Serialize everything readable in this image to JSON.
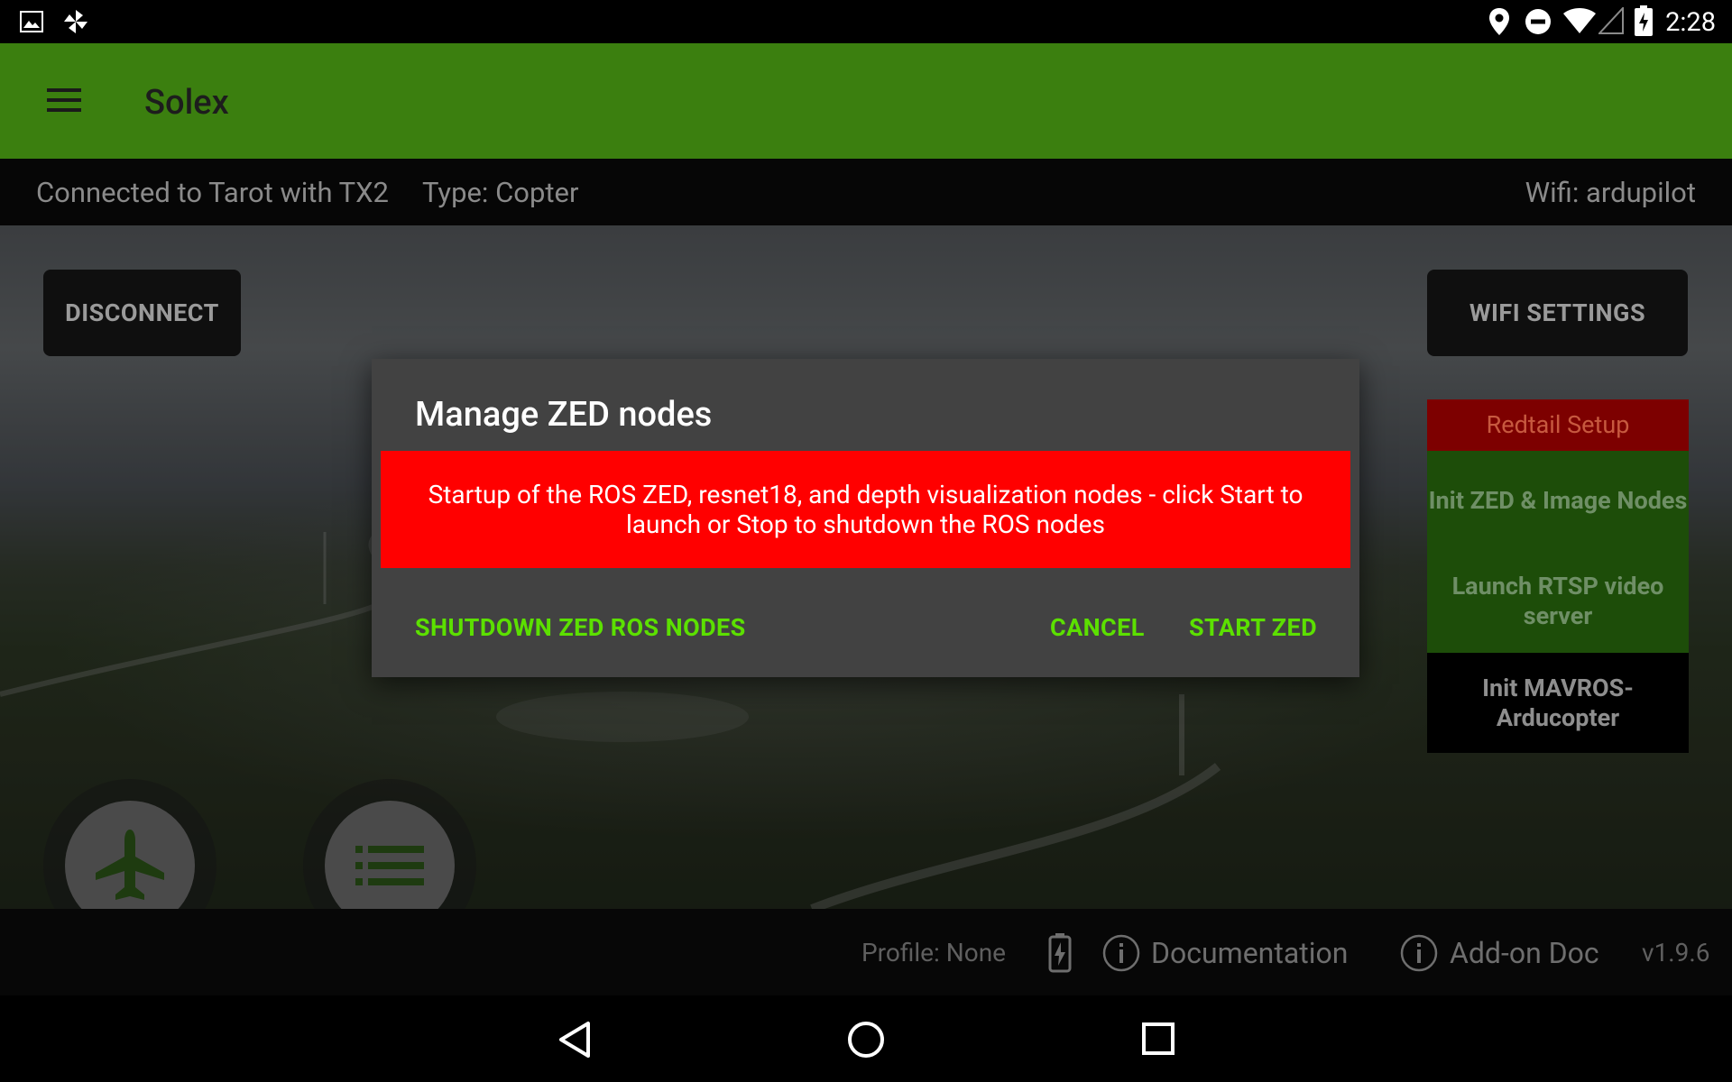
{
  "status_bar": {
    "time": "2:28",
    "icons": [
      "image-icon",
      "pinwheel-icon",
      "location-icon",
      "do-not-disturb-icon",
      "wifi-icon",
      "cell-signal-icon",
      "battery-charging-icon"
    ]
  },
  "app_bar": {
    "title": "Solex",
    "color": "#3b7f0f"
  },
  "info_bar": {
    "connection": "Connected to Tarot with TX2",
    "type": "Type: Copter",
    "wifi": "Wifi: ardupilot"
  },
  "buttons": {
    "disconnect": "DISCONNECT",
    "wifi_settings": "WIFI SETTINGS"
  },
  "redtail_panel": {
    "header": "Redtail Setup",
    "items": [
      "Init ZED & Image Nodes",
      "Launch RTSP video server",
      "Init MAVROS-Arducopter"
    ]
  },
  "fabs": [
    "airplane-icon",
    "list-icon"
  ],
  "bottom_bar": {
    "profile": "Profile: None",
    "documentation": "Documentation",
    "addon_doc": "Add-on Doc",
    "version": "v1.9.6"
  },
  "dialog": {
    "title": "Manage ZED nodes",
    "message": "Startup of the ROS ZED, resnet18, and depth visualization nodes - click Start to launch or Stop to shutdown the ROS nodes",
    "message_bg": "#ff0000",
    "button_color": "#5ce000",
    "shutdown_label": "SHUTDOWN ZED ROS NODES",
    "cancel_label": "CANCEL",
    "start_label": "START ZED"
  },
  "nav_bar": [
    "back-icon",
    "home-icon",
    "recents-icon"
  ]
}
